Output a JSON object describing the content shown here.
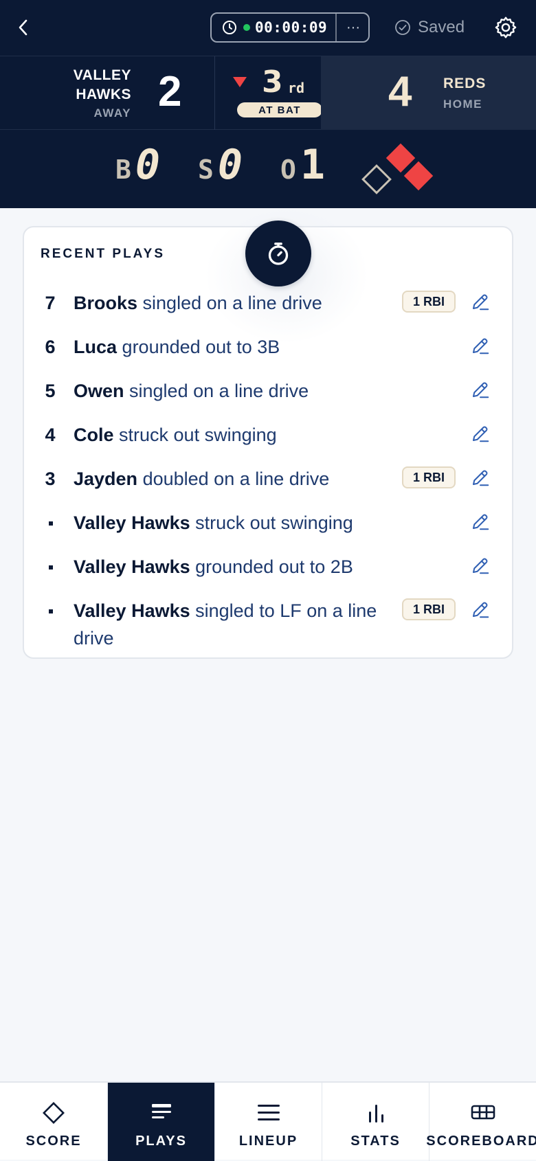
{
  "header": {
    "timer": "00:00:09",
    "more_label": "···",
    "saved_label": "Saved",
    "icons": [
      "back-chevron-icon",
      "clock-icon",
      "check-circle-icon",
      "gear-icon"
    ]
  },
  "scoreboard": {
    "away": {
      "name_line1": "VALLEY",
      "name_line2": "HAWKS",
      "role": "AWAY",
      "runs": "2"
    },
    "inning": {
      "number": "3",
      "suffix": "rd",
      "half_indicator": "bottom",
      "status": "AT BAT"
    },
    "home": {
      "name": "REDS",
      "role": "HOME",
      "runs": "4"
    }
  },
  "count": {
    "balls_label": "B",
    "balls": "0",
    "strikes_label": "S",
    "strikes": "0",
    "outs_label": "O",
    "outs": "1",
    "bases": {
      "first": false,
      "second": true,
      "third": false,
      "home_occupied": true
    }
  },
  "recent_plays": {
    "title": "RECENT PLAYS",
    "items": [
      {
        "num": "7",
        "player": "Brooks",
        "desc": "singled on a line drive",
        "rbi": "1 RBI"
      },
      {
        "num": "6",
        "player": "Luca",
        "desc": "grounded out to 3B",
        "rbi": ""
      },
      {
        "num": "5",
        "player": "Owen",
        "desc": "singled on a line drive",
        "rbi": ""
      },
      {
        "num": "4",
        "player": "Cole",
        "desc": "struck out swinging",
        "rbi": ""
      },
      {
        "num": "3",
        "player": "Jayden",
        "desc": "doubled on a line drive",
        "rbi": "1 RBI"
      },
      {
        "num": "",
        "player": "Valley Hawks",
        "desc": "struck out swinging",
        "rbi": ""
      },
      {
        "num": "",
        "player": "Valley Hawks",
        "desc": "grounded out to 2B",
        "rbi": ""
      },
      {
        "num": "",
        "player": "Valley Hawks",
        "desc": "singled to LF on a line drive",
        "rbi": "1 RBI"
      }
    ]
  },
  "nav": {
    "tabs": [
      {
        "label": "SCORE",
        "icon": "diamond-icon",
        "active": false
      },
      {
        "label": "PLAYS",
        "icon": "plays-list-icon",
        "active": true
      },
      {
        "label": "LINEUP",
        "icon": "lineup-list-icon",
        "active": false
      },
      {
        "label": "STATS",
        "icon": "bar-chart-icon",
        "active": false
      },
      {
        "label": "SCOREBOARD",
        "icon": "scoreboard-icon",
        "active": false
      }
    ]
  },
  "colors": {
    "navy": "#0b1934",
    "accent_red": "#ef4444",
    "cream": "#f2e6d0",
    "link_blue": "#1e3a6e",
    "green_dot": "#22c55e"
  }
}
